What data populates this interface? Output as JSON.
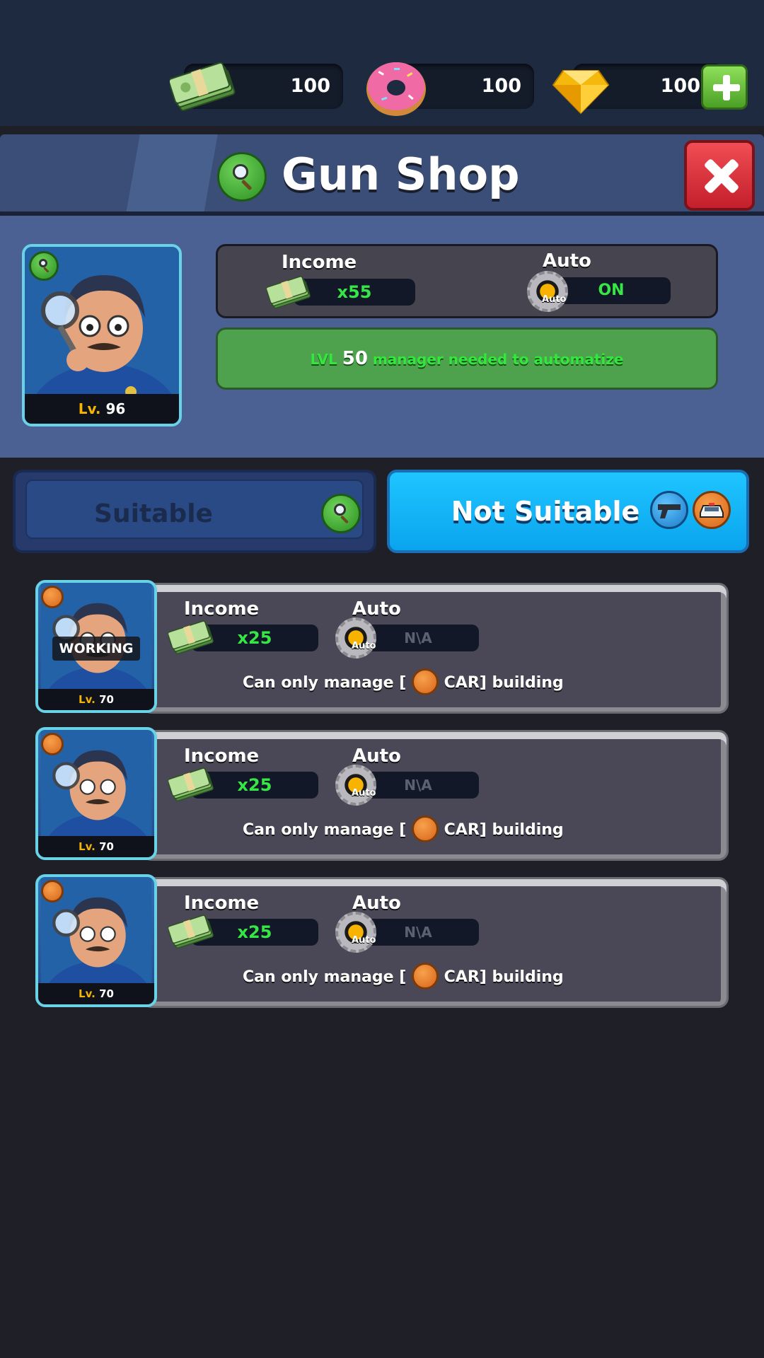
{
  "resources": {
    "cash": "100",
    "donuts": "100",
    "gems": "100"
  },
  "header": {
    "title": "Gun Shop"
  },
  "assigned_manager": {
    "level_prefix": "Lv.",
    "level": "96",
    "income_label": "Income",
    "income_value": "x55",
    "auto_label": "Auto",
    "auto_icon_text": "Auto",
    "auto_value": "ON",
    "notice_prefix": "LVL",
    "notice_level": "50",
    "notice_suffix": "manager needed to automatize"
  },
  "tabs": {
    "suitable": "Suitable",
    "not_suitable": "Not Suitable"
  },
  "manager_list": [
    {
      "level_prefix": "Lv.",
      "level": "70",
      "status": "WORKING",
      "income_label": "Income",
      "income_value": "x25",
      "auto_label": "Auto",
      "auto_icon_text": "Auto",
      "auto_value": "N\\A",
      "note_prefix": "Can only manage [",
      "note_suffix": "CAR] building"
    },
    {
      "level_prefix": "Lv.",
      "level": "70",
      "income_label": "Income",
      "income_value": "x25",
      "auto_label": "Auto",
      "auto_icon_text": "Auto",
      "auto_value": "N\\A",
      "note_prefix": "Can only manage [",
      "note_suffix": "CAR] building"
    },
    {
      "level_prefix": "Lv.",
      "level": "70",
      "income_label": "Income",
      "income_value": "x25",
      "auto_label": "Auto",
      "auto_icon_text": "Auto",
      "auto_value": "N\\A",
      "note_prefix": "Can only manage [",
      "note_suffix": "CAR] building"
    }
  ],
  "icons": {
    "cash": "cash-stack-icon",
    "donut": "donut-icon",
    "gem": "gem-icon",
    "plus": "plus-icon",
    "search": "magnifier-icon",
    "close": "close-icon",
    "gun": "pistol-icon",
    "car": "police-car-icon",
    "gear": "gear-icon"
  },
  "colors": {
    "green_text": "#36e645",
    "tab_active": "#1fc5ff",
    "close_red": "#e33340",
    "level_gold": "#f4b400"
  }
}
